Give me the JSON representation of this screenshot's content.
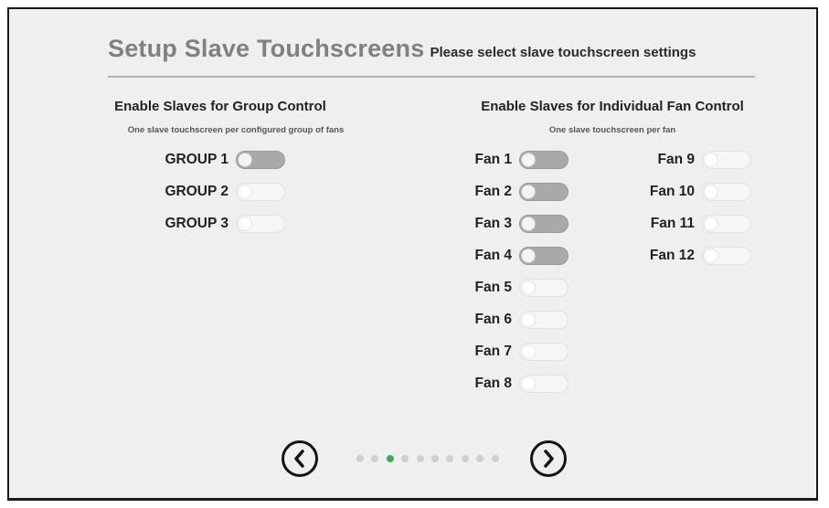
{
  "header": {
    "title": "Setup Slave Touchscreens",
    "subtitle": "Please select slave touchscreen settings"
  },
  "group_control": {
    "heading": "Enable Slaves for Group Control",
    "subheading": "One slave touchscreen per configured group of fans",
    "items": [
      {
        "label": "GROUP 1",
        "enabled": true
      },
      {
        "label": "GROUP 2",
        "enabled": false
      },
      {
        "label": "GROUP 3",
        "enabled": false
      }
    ]
  },
  "fan_control": {
    "heading": "Enable Slaves for Individual Fan Control",
    "subheading": "One slave touchscreen per fan",
    "fans": [
      {
        "label": "Fan 1",
        "enabled": true
      },
      {
        "label": "Fan 2",
        "enabled": true
      },
      {
        "label": "Fan 3",
        "enabled": true
      },
      {
        "label": "Fan 4",
        "enabled": true
      },
      {
        "label": "Fan 5",
        "enabled": false
      },
      {
        "label": "Fan 6",
        "enabled": false
      },
      {
        "label": "Fan 7",
        "enabled": false
      },
      {
        "label": "Fan 8",
        "enabled": false
      },
      {
        "label": "Fan 9",
        "enabled": false
      },
      {
        "label": "Fan 10",
        "enabled": false
      },
      {
        "label": "Fan 11",
        "enabled": false
      },
      {
        "label": "Fan 12",
        "enabled": false
      }
    ]
  },
  "pagination": {
    "total_pages": 10,
    "current_page": 3,
    "active_color": "#3ab054",
    "inactive_color": "#cfcfcf",
    "prev_icon": "chevron-left-icon",
    "next_icon": "chevron-right-icon"
  }
}
